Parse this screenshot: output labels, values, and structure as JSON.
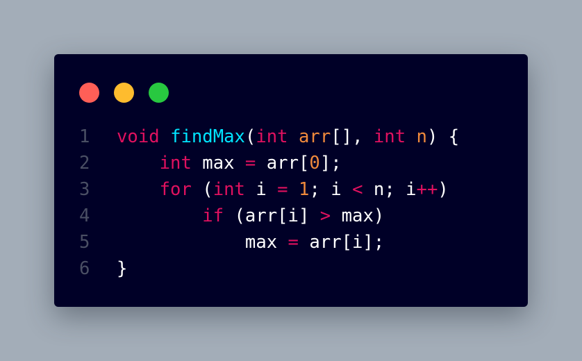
{
  "colors": {
    "background": "#a3adb8",
    "window": "#000027",
    "dot_red": "#ff5f57",
    "dot_yellow": "#febc2e",
    "dot_green": "#28c840",
    "line_number": "#4a4f64",
    "plain": "#ffffff",
    "keyword": "#e0115f",
    "function": "#00e5ff",
    "param": "#f08a3c",
    "number": "#f08a3c",
    "operator": "#e0115f"
  },
  "window_controls": [
    {
      "name": "close-dot",
      "color": "dot_red"
    },
    {
      "name": "minimize-dot",
      "color": "dot_yellow"
    },
    {
      "name": "maximize-dot",
      "color": "dot_green"
    }
  ],
  "code": {
    "lines": [
      {
        "number": "1",
        "tokens": [
          {
            "text": "void",
            "type": "keyword"
          },
          {
            "text": " ",
            "type": "plain"
          },
          {
            "text": "findMax",
            "type": "function"
          },
          {
            "text": "(",
            "type": "plain"
          },
          {
            "text": "int",
            "type": "keyword"
          },
          {
            "text": " ",
            "type": "plain"
          },
          {
            "text": "arr",
            "type": "param"
          },
          {
            "text": "[], ",
            "type": "plain"
          },
          {
            "text": "int",
            "type": "keyword"
          },
          {
            "text": " ",
            "type": "plain"
          },
          {
            "text": "n",
            "type": "param"
          },
          {
            "text": ") {",
            "type": "plain"
          }
        ]
      },
      {
        "number": "2",
        "tokens": [
          {
            "text": "    ",
            "type": "plain"
          },
          {
            "text": "int",
            "type": "keyword"
          },
          {
            "text": " max ",
            "type": "plain"
          },
          {
            "text": "=",
            "type": "operator"
          },
          {
            "text": " arr[",
            "type": "plain"
          },
          {
            "text": "0",
            "type": "number"
          },
          {
            "text": "];",
            "type": "plain"
          }
        ]
      },
      {
        "number": "3",
        "tokens": [
          {
            "text": "    ",
            "type": "plain"
          },
          {
            "text": "for",
            "type": "keyword"
          },
          {
            "text": " (",
            "type": "plain"
          },
          {
            "text": "int",
            "type": "keyword"
          },
          {
            "text": " i ",
            "type": "plain"
          },
          {
            "text": "=",
            "type": "operator"
          },
          {
            "text": " ",
            "type": "plain"
          },
          {
            "text": "1",
            "type": "number"
          },
          {
            "text": "; i ",
            "type": "plain"
          },
          {
            "text": "<",
            "type": "operator"
          },
          {
            "text": " n; i",
            "type": "plain"
          },
          {
            "text": "++",
            "type": "operator"
          },
          {
            "text": ")",
            "type": "plain"
          }
        ]
      },
      {
        "number": "4",
        "tokens": [
          {
            "text": "        ",
            "type": "plain"
          },
          {
            "text": "if",
            "type": "keyword"
          },
          {
            "text": " (arr[i] ",
            "type": "plain"
          },
          {
            "text": ">",
            "type": "operator"
          },
          {
            "text": " max)",
            "type": "plain"
          }
        ]
      },
      {
        "number": "5",
        "tokens": [
          {
            "text": "            max ",
            "type": "plain"
          },
          {
            "text": "=",
            "type": "operator"
          },
          {
            "text": " arr[i];",
            "type": "plain"
          }
        ]
      },
      {
        "number": "6",
        "tokens": [
          {
            "text": "}",
            "type": "plain"
          }
        ]
      }
    ]
  }
}
